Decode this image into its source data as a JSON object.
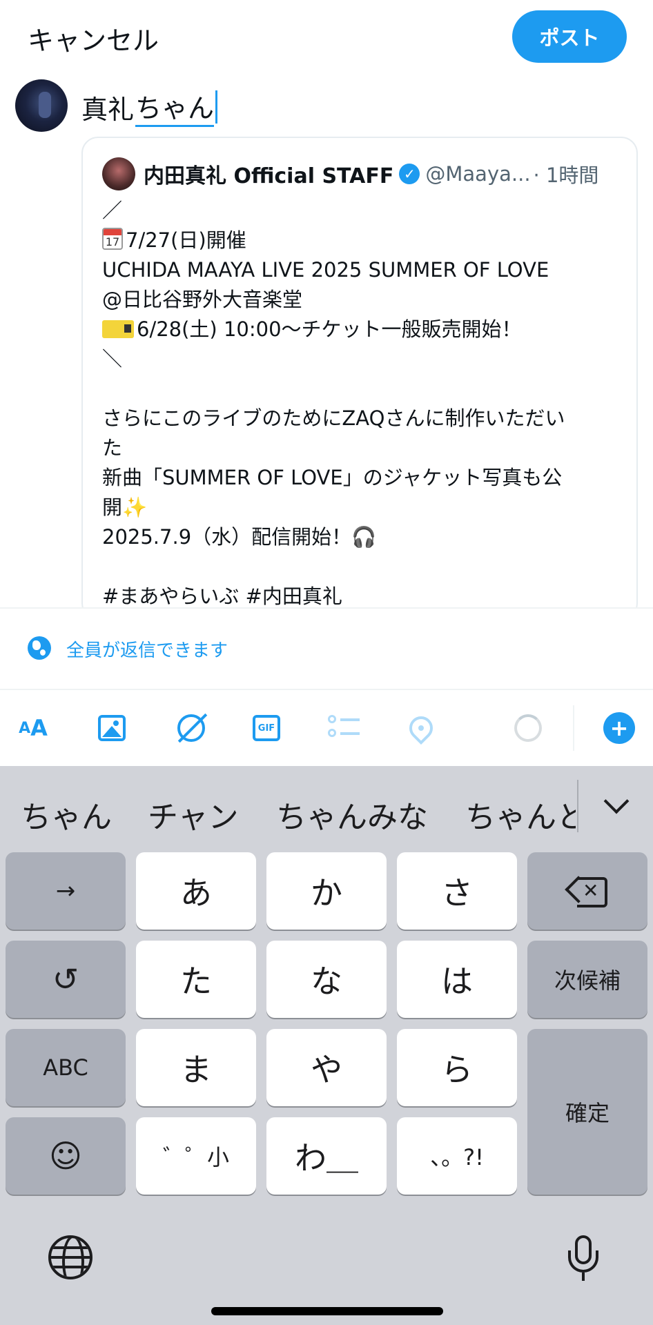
{
  "header": {
    "cancel_label": "キャンセル",
    "post_label": "ポスト"
  },
  "compose": {
    "text_plain": "真礼",
    "text_marked": "ちゃん"
  },
  "quote": {
    "name": "内田真礼 Official STAFF",
    "handle": "@Maaya...",
    "time": "· 1時間",
    "calendar_day": "17",
    "lines": [
      "／",
      "7/27(日)開催",
      "UCHIDA MAAYA LIVE 2025 SUMMER OF LOVE",
      " @日比谷野外大音楽堂",
      "6/28(土) 10:00～チケット一般販売開始！",
      "＼",
      "",
      "さらにこのライブのためにZAQさんに制作いただい",
      "た",
      "新曲「SUMMER OF LOVE」のジャケット写真も公",
      "開",
      "2025.7.9（水）配信開始！",
      "",
      "#まあやらいぶ #内田真礼"
    ],
    "sparkle": "✨",
    "headphones": "🎧"
  },
  "reply_setting": {
    "label": "全員が返信できます"
  },
  "toolbar": {
    "aa_small": "A",
    "aa_big": "A",
    "gif_label": "GIF",
    "add_label": "+",
    "icons": [
      "text-size-icon",
      "image-icon",
      "grok-icon",
      "gif-icon",
      "poll-icon",
      "location-icon",
      "char-count-ring",
      "add-post-icon"
    ]
  },
  "keyboard": {
    "candidates": [
      "ちゃん",
      "チャン",
      "ちゃんみな",
      "ちゃんと"
    ],
    "rows": [
      [
        "→",
        "あ",
        "か",
        "さ"
      ],
      [
        "↺",
        "た",
        "な",
        "は",
        "次候補"
      ],
      [
        "ABC",
        "ま",
        "や",
        "ら",
        "確定"
      ],
      [
        "☺",
        "ﾞﾟ小",
        "わ_",
        "、。?!"
      ]
    ],
    "emoji_glyph": "☺",
    "undo_glyph": "↺",
    "arrow_glyph": "→",
    "dakuten_key": "゛゜小",
    "wa_key": "わ＿",
    "punct_key": "、。?!"
  }
}
